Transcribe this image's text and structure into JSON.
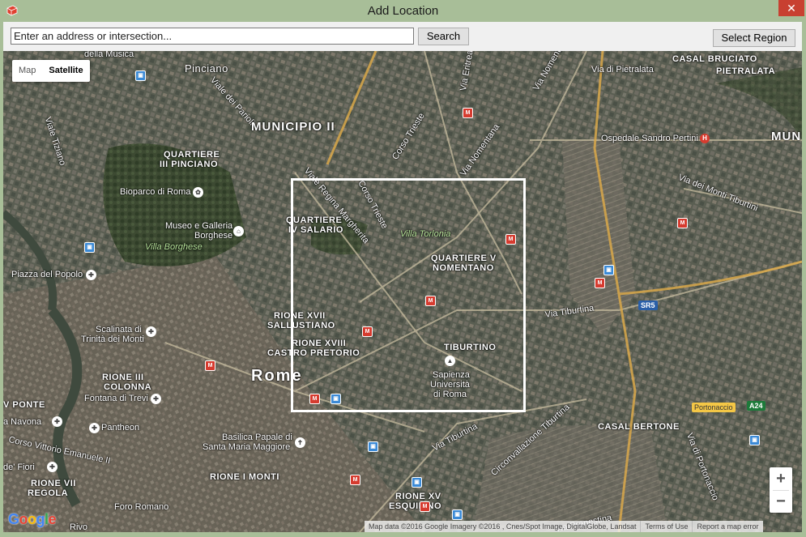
{
  "window": {
    "title": "Add Location",
    "close_glyph": "✕"
  },
  "toolbar": {
    "search_placeholder": "Enter an address or intersection...",
    "search_label": "Search",
    "select_region_label": "Select Region"
  },
  "map": {
    "type_control": {
      "map_label": "Map",
      "satellite_label": "Satellite",
      "selected": "Satellite"
    },
    "zoom": {
      "in_glyph": "+",
      "out_glyph": "−"
    },
    "attribution": {
      "data": "Map data ©2016 Google Imagery ©2016 , Cnes/Spot Image, DigitalGlobe, Landsat",
      "terms": "Terms of Use",
      "report": "Report a map error"
    },
    "google_logo": "Google",
    "labels": {
      "della_musica": "della Musica",
      "pinciano": "Pinciano",
      "viale_parioli": "Viale dei Parioli",
      "municipio": "MUNICIPIO II",
      "corso_trieste_top": "Corso Trieste",
      "via_nomentana_top": "Via Nomentana",
      "via_nomentana_mid": "Via Nomentana",
      "via_eritrea": "Via Eritrea",
      "viale_tiziano": "Viale Tiziano",
      "quartiere_pinciano_1": "QUARTIERE",
      "quartiere_pinciano_2": "III PINCIANO",
      "bioparco": "Bioparco di Roma",
      "museo_1": "Museo e Galleria",
      "museo_2": "Borghese",
      "villa_borghese": "Villa Borghese",
      "piazza_popolo": "Piazza del Popolo",
      "viale_regina": "Viale Regina Margherita",
      "corso_trieste_mid": "Corso Trieste",
      "quartiere_salario_1": "QUARTIERE",
      "quartiere_salario_2": "IV SALARIO",
      "villa_torlonia": "Villa Torlonia",
      "quartiere_nomentano_1": "QUARTIERE V",
      "quartiere_nomentano_2": "NOMENTANO",
      "rione_sallustiano_1": "RIONE XVII",
      "rione_sallustiano_2": "SALLUSTIANO",
      "rione_castro_1": "RIONE XVIII",
      "rione_castro_2": "CASTRO PRETORIO",
      "tiburtino": "TIBURTINO",
      "sapienza_1": "Sapienza",
      "sapienza_2": "Università",
      "sapienza_3": "di Roma",
      "rome": "Rome",
      "scalinata_1": "Scalinata di",
      "scalinata_2": "Trinità dei Monti",
      "rione_colonna_1": "RIONE III",
      "rione_colonna_2": "COLONNA",
      "fontana": "Fontana di Trevi",
      "v_ponte": "V PONTE",
      "navona": "a Navona",
      "pantheon": "Pantheon",
      "corso_vittorio": "Corso Vittorio Emanuele II",
      "fiori": "de' Fiori",
      "rione_regola_1": "RIONE VII",
      "rione_regola_2": "REGOLA",
      "basilica_1": "Basilica Papale di",
      "basilica_2": "Santa Maria Maggiore",
      "rione_monti": "RIONE I MONTI",
      "rione_esquilino_1": "RIONE XV",
      "rione_esquilino_2": "ESQUILINO",
      "foro_romano": "Foro Romano",
      "via_pietralata": "Via di Pietralata",
      "pietralata": "PIETRALATA",
      "casal_bruciato": "CASAL BRUCIATO",
      "mun": "MUN",
      "ospedale": "Ospedale Sandro Pertini",
      "via_monti_tiburtini": "Via dei Monti Tiburtini",
      "via_tiburtina_east": "Via Tiburtina",
      "sr5": "SR5",
      "portonaccio": "Portonaccio",
      "a24": "A24",
      "casal_bertone": "CASAL BERTONE",
      "via_tiburtina_south": "Via Tiburtina",
      "circonvallazione": "Circonvallazione Tiburtina",
      "via_portonaccio": "Via di Portonaccio",
      "via_prenestina": "Via Prenestina",
      "rivo": "Rivo"
    }
  }
}
